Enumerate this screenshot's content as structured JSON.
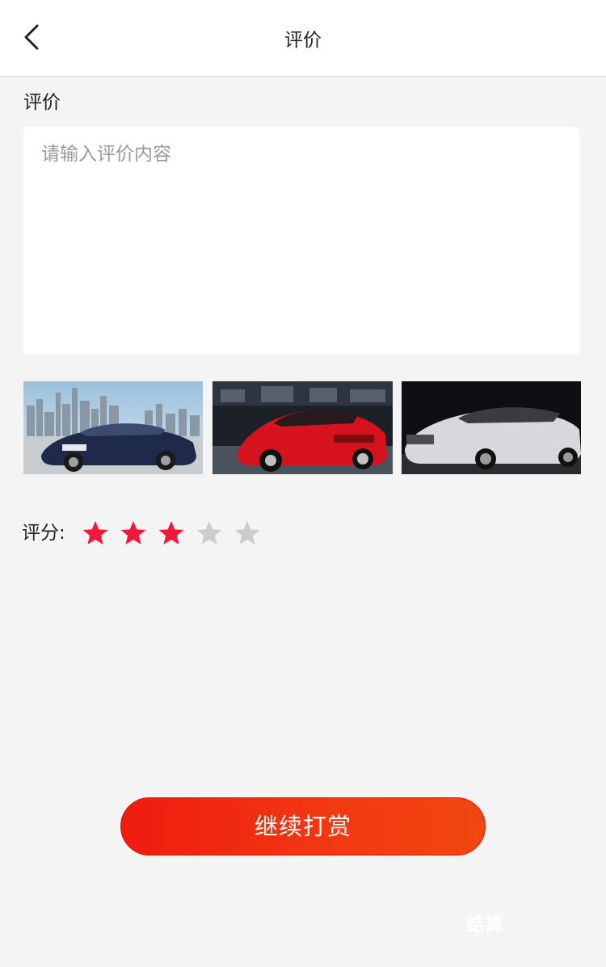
{
  "navbar": {
    "title": "评价",
    "back_icon": "chevron-left-icon"
  },
  "review": {
    "section_label": "评价",
    "placeholder": "请输入评价内容",
    "value": ""
  },
  "photos": [
    {
      "name": "photo-dark-blue-car"
    },
    {
      "name": "photo-red-car"
    },
    {
      "name": "photo-silver-car"
    }
  ],
  "rating": {
    "label": "评分:",
    "value": 3,
    "max": 5,
    "active_color": "#f0193a",
    "inactive_color": "#cccccc"
  },
  "actions": {
    "continue_label": "继续打赏",
    "settle_label": "结算",
    "button_color": "#ef1b10"
  }
}
